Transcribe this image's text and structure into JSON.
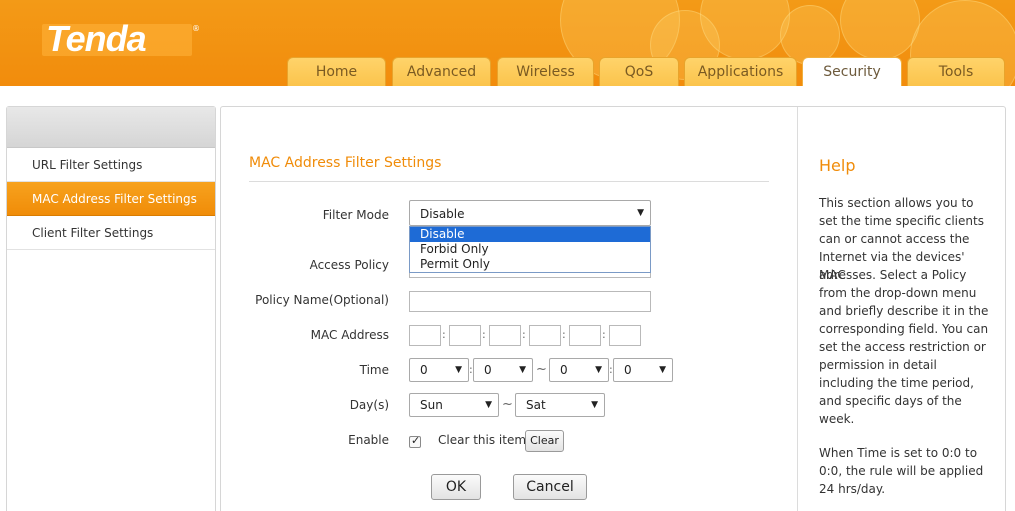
{
  "brand": {
    "logo_text": "Tenda",
    "registered_mark": "®"
  },
  "nav": {
    "tabs": [
      "Home",
      "Advanced",
      "Wireless",
      "QoS",
      "Applications",
      "Security",
      "Tools"
    ],
    "active": "Security"
  },
  "sidebar": {
    "items": [
      {
        "label": "URL Filter Settings"
      },
      {
        "label": "MAC Address Filter Settings",
        "active": true
      },
      {
        "label": "Client Filter Settings"
      }
    ]
  },
  "form": {
    "title": "MAC Address Filter Settings",
    "filter_mode": {
      "label": "Filter Mode",
      "value": "Disable",
      "options": [
        "Disable",
        "Forbid Only",
        "Permit Only"
      ],
      "highlighted": "Disable"
    },
    "access_policy": {
      "label": "Access Policy"
    },
    "policy_name": {
      "label": "Policy Name(Optional)",
      "value": ""
    },
    "mac_address": {
      "label": "MAC Address",
      "octets": [
        "",
        "",
        "",
        "",
        "",
        ""
      ],
      "separator": ":"
    },
    "time": {
      "label": "Time",
      "start_hour": "0",
      "start_min": "0",
      "end_hour": "0",
      "end_min": "0",
      "colon": ":",
      "range_sep": "~"
    },
    "days": {
      "label": "Day(s)",
      "start": "Sun",
      "end": "Sat",
      "range_sep": "~"
    },
    "enable": {
      "label": "Enable",
      "checked": true,
      "clear_label": "Clear this item:",
      "clear_button": "Clear"
    },
    "ok_button": "OK",
    "cancel_button": "Cancel"
  },
  "help": {
    "title": "Help",
    "paragraph1": [
      "This section allows you to",
      "set the time specific clients",
      "can or cannot access the",
      "Internet via the devices' MAC",
      "adresses. Select a Policy",
      "from the drop-down menu",
      "and briefly describe it in the",
      "corresponding field. You can",
      "set the access restriction or",
      "permission in detail",
      "including the time period,",
      "and specific days of the",
      "week."
    ],
    "paragraph2": [
      "When Time is set to 0:0 to",
      "0:0, the rule will be applied",
      "24 hrs/day."
    ]
  },
  "colors": {
    "accent": "#f08c0a",
    "header": "#f39a17",
    "selection": "#1e6bd6"
  },
  "icons": {
    "select_arrow": "▼",
    "checkmark": "✓"
  }
}
